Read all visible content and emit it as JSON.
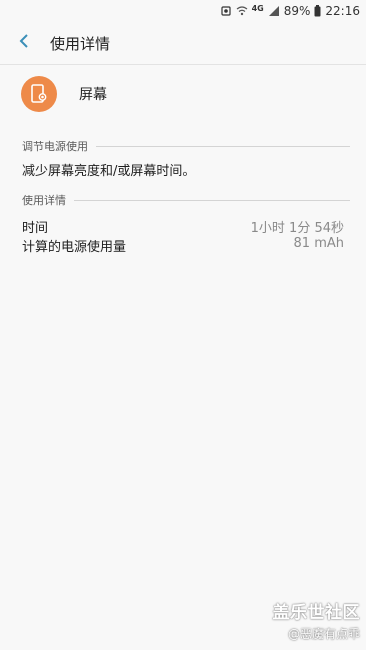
{
  "status_bar": {
    "network": "4G",
    "battery": "89%",
    "time": "22:16"
  },
  "app_bar": {
    "title": "使用详情"
  },
  "item": {
    "name": "屏幕",
    "icon": "phone-brightness-icon",
    "icon_color": "#ee8a49"
  },
  "adjust_section": {
    "label": "调节电源使用",
    "tip": "减少屏幕亮度和/或屏幕时间。"
  },
  "details_section": {
    "label": "使用详情",
    "rows": [
      {
        "label": "时间",
        "value": "1小时 1分 54秒"
      },
      {
        "label": "计算的电源使用量",
        "value": "81 mAh"
      }
    ]
  },
  "watermark": {
    "brand": "盖乐世社区",
    "user": "@恶魔有点乖"
  }
}
